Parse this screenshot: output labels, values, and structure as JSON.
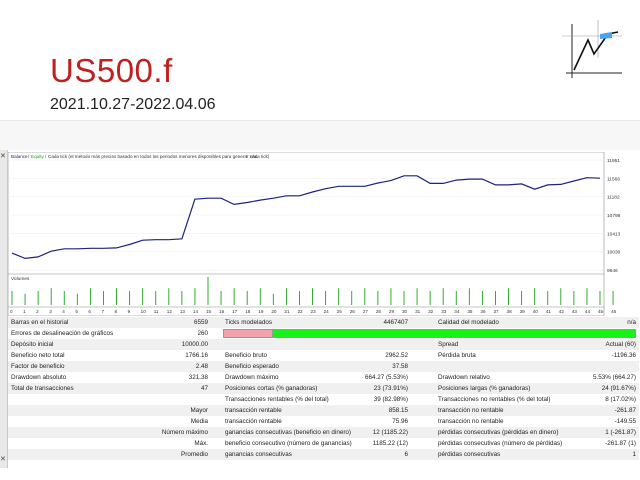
{
  "header": {
    "symbol": "US500.f",
    "date_range": "2021.10.27-2022.04.06"
  },
  "chart_legend": {
    "balance": "Balance",
    "equity": "Equity",
    "desc": "Cada tick (el método más preciso basado en todos los periodos menores disponibles para generar cada tick)",
    "na": "n/a"
  },
  "volumes_label": "Volumes",
  "colors": {
    "balance_line": "#1a237e",
    "volume_bar": "#1aa31a",
    "bar_red": "#f3a2ab",
    "bar_green": "#19f219",
    "title": "#c0211f"
  },
  "chart_data": {
    "type": "line",
    "series": [
      {
        "name": "Balance",
        "values": [
          10000,
          9890,
          9920,
          10040,
          10090,
          10090,
          10100,
          10100,
          10110,
          10180,
          10270,
          10280,
          10280,
          10300,
          11130,
          11150,
          11150,
          11020,
          11060,
          11110,
          11150,
          11200,
          11200,
          11280,
          11350,
          11400,
          11400,
          11400,
          11470,
          11520,
          11620,
          11620,
          11460,
          11460,
          11530,
          11550,
          11550,
          11430,
          11430,
          11450,
          11340,
          11430,
          11440,
          11510,
          11580,
          11570
        ]
      }
    ],
    "y_ticks": [
      "11951",
      "11566",
      "11182",
      "10798",
      "10413",
      "10030",
      "9646"
    ],
    "ylim": [
      9646,
      11951
    ],
    "x_ticks": [
      "0",
      "1",
      "2",
      "3",
      "4",
      "5",
      "6",
      "7",
      "8",
      "9",
      "10",
      "11",
      "12",
      "13",
      "14",
      "15",
      "16",
      "17",
      "18",
      "19",
      "20",
      "21",
      "22",
      "23",
      "24",
      "25",
      "26",
      "27",
      "28",
      "29",
      "30",
      "31",
      "32",
      "33",
      "34",
      "35",
      "36",
      "37",
      "38",
      "39",
      "40",
      "41",
      "42",
      "43",
      "44",
      "45",
      "46"
    ],
    "volumes": [
      0.5,
      0.4,
      0.5,
      0.6,
      0.5,
      0.4,
      0.6,
      0.5,
      0.6,
      0.5,
      0.6,
      0.5,
      0.6,
      0.5,
      0.6,
      1.0,
      0.5,
      0.6,
      0.5,
      0.6,
      0.4,
      0.6,
      0.5,
      0.6,
      0.5,
      0.6,
      0.5,
      0.6,
      0.5,
      0.6,
      0.5,
      0.6,
      0.5,
      0.6,
      0.5,
      0.6,
      0.5,
      0.5,
      0.6,
      0.5,
      0.6,
      0.5,
      0.6,
      0.5,
      0.6,
      0.5,
      0.5
    ]
  },
  "stats": {
    "barras_label": "Barras en el historial",
    "barras": "6559",
    "ticks_label": "Ticks modelados",
    "ticks": "4467407",
    "calidad_label": "Calidad del modelado",
    "calidad": "n/a",
    "errores_label": "Errores de desalineación de gráficos",
    "errores": "260",
    "deposito_label": "Depósito inicial",
    "deposito": "10000.00",
    "spread_label": "Spread",
    "spread": "Actual (60)",
    "beneficio_neto_label": "Beneficio neto total",
    "beneficio_neto": "1766.16",
    "beneficio_bruto_label": "Beneficio bruto",
    "beneficio_bruto": "2962.52",
    "perdida_bruta_label": "Pérdida bruta",
    "perdida_bruta": "-1196.36",
    "factor_label": "Factor de beneficio",
    "factor": "2.48",
    "esperado_label": "Beneficio esperado",
    "esperado": "37.58",
    "dd_abs_label": "Drawdown absoluto",
    "dd_abs": "321.38",
    "dd_max_label": "Drawdown máximo",
    "dd_max": "664.27 (5.53%)",
    "dd_rel_label": "Drawdown relativo",
    "dd_rel": "5.53% (664.27)",
    "total_tx_label": "Total de transacciones",
    "total_tx": "47",
    "cortas_label": "Posiciones cortas (% ganadoras)",
    "cortas": "23 (73.91%)",
    "largas_label": "Posiciones largas (% ganadoras)",
    "largas": "24 (91.67%)",
    "rentables_label": "Transacciones rentables (% del total)",
    "rentables": "39 (82.98%)",
    "no_rentables_label": "Transacciones no rentables (% del total)",
    "no_rentables": "8 (17.02%)",
    "mayor_label": "Mayor",
    "mayor_tr_label": "transacción rentable",
    "mayor_tr": "858.15",
    "mayor_tnr_label": "transacción no rentable",
    "mayor_tnr": "-261.87",
    "media_label": "Media",
    "media_tr_label": "transacción rentable",
    "media_tr": "75.96",
    "media_tnr_label": "transacción no rentable",
    "media_tnr": "-149.55",
    "nmax_label": "Número máximo",
    "nmax_g_label": "ganancias consecutivas (beneficio en dinero)",
    "nmax_g": "12 (1185.22)",
    "nmax_p_label": "pérdidas consecutivas (pérdidas en dinero)",
    "nmax_p": "1 (-261.87)",
    "max_label": "Máx.",
    "max_g_label": "beneficio consecutivo (número de ganancias)",
    "max_g": "1185.22 (12)",
    "max_p_label": "pérdidas consecutivas (número de pérdidas)",
    "max_p": "-261.87 (1)",
    "prom_label": "Promedio",
    "prom_g_label": "ganancias consecutivas",
    "prom_g": "6",
    "prom_p_label": "pérdidas consecutivas",
    "prom_p": "1"
  }
}
